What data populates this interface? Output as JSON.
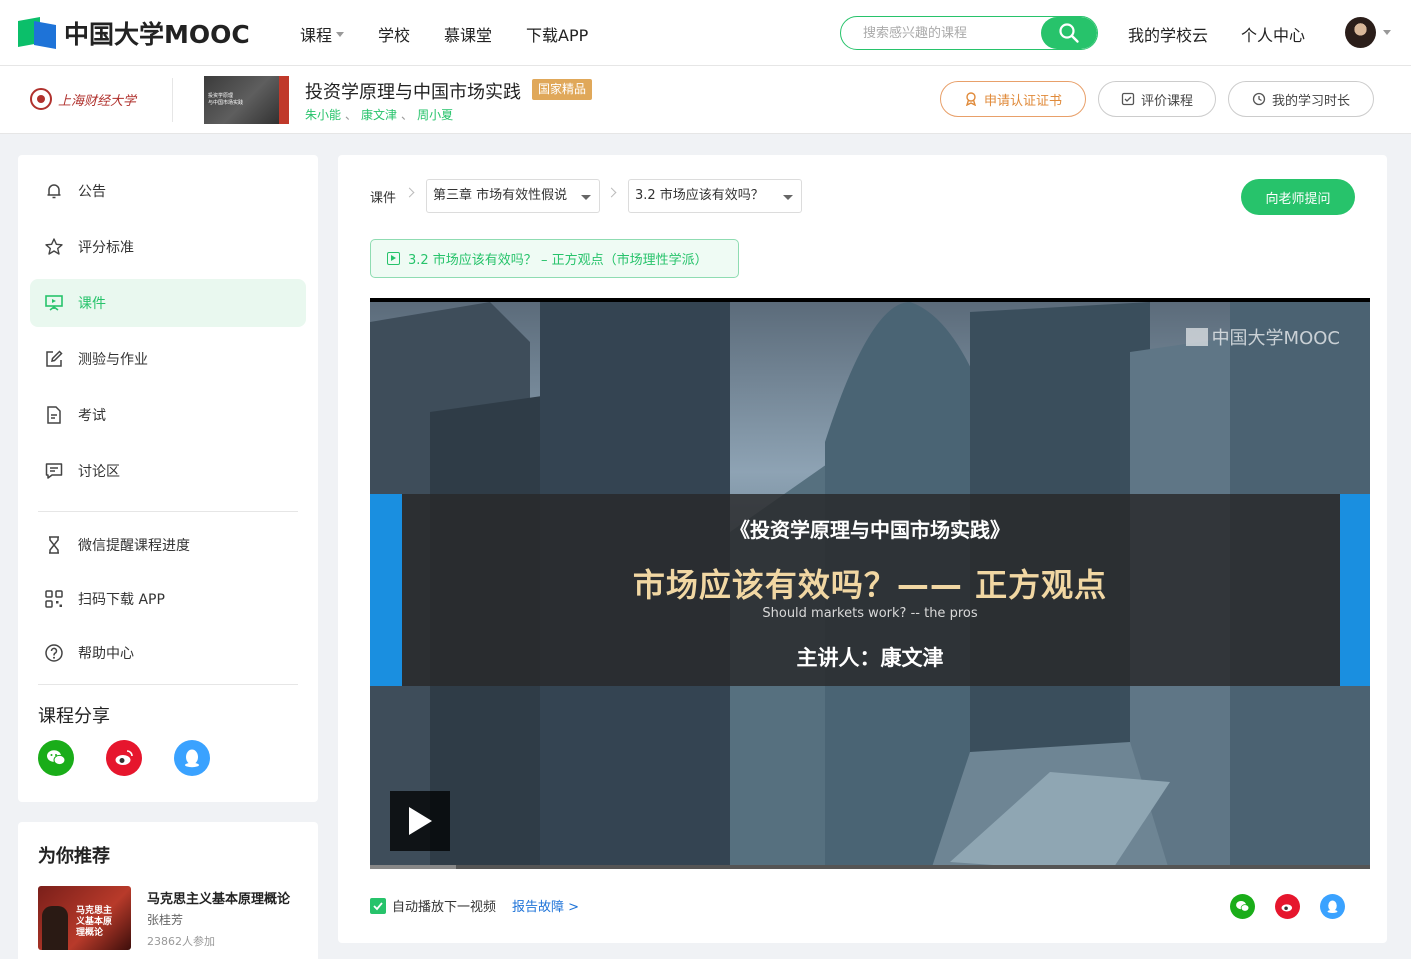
{
  "topbar": {
    "logo_text": "中国大学MOOC",
    "nav": [
      "课程",
      "学校",
      "慕课堂",
      "下载APP"
    ],
    "search_placeholder": "搜索感兴趣的课程",
    "my_school_cloud": "我的学校云",
    "personal_center": "个人中心"
  },
  "course": {
    "school_name": "上海财经大学",
    "thumb_line1": "投资学原理",
    "thumb_line2": "与中国市场实践",
    "title": "投资学原理与中国市场实践",
    "badge": "国家精品",
    "teachers": [
      "朱小能",
      "康文津",
      "周小夏"
    ],
    "teacher_sep": "、",
    "btn_cert": "申请认证证书",
    "btn_review": "评价课程",
    "btn_time": "我的学习时长"
  },
  "sidebar": {
    "items": [
      {
        "label": "公告",
        "icon": "bell-icon"
      },
      {
        "label": "评分标准",
        "icon": "star-icon"
      },
      {
        "label": "课件",
        "icon": "courseware-icon",
        "active": true
      },
      {
        "label": "测验与作业",
        "icon": "edit-icon"
      },
      {
        "label": "考试",
        "icon": "document-icon"
      },
      {
        "label": "讨论区",
        "icon": "chat-icon"
      }
    ],
    "tools": [
      {
        "label": "微信提醒课程进度",
        "icon": "hourglass-icon"
      },
      {
        "label": "扫码下载 APP",
        "icon": "qr-icon"
      },
      {
        "label": "帮助中心",
        "icon": "help-icon"
      }
    ],
    "share_title": "课程分享"
  },
  "recommend": {
    "title": "为你推荐",
    "thumb_text": "马克思主义基本原理概论",
    "name": "马克思主义基本原理概论",
    "teacher": "张桂芳",
    "count": "23862人参加"
  },
  "main": {
    "crumb_label": "课件",
    "chapter_select": "第三章 市场有效性假说",
    "unit_select": "3.2 市场应该有效吗？",
    "ask_btn": "向老师提问",
    "unit_tag": "3.2 市场应该有效吗？ – 正方观点（市场理性学派）",
    "video": {
      "watermark": "中国大学MOOC",
      "line1": "《投资学原理与中国市场实践》",
      "line2": "市场应该有效吗？—— 正方观点",
      "line3": "Should markets work? -- the pros",
      "line4": "主讲人：康文津",
      "progress": 0.086
    },
    "autoplay_label": "自动播放下一视频",
    "autoplay_checked": true,
    "report_label": "报告故障 >"
  },
  "colors": {
    "accent": "#27c36b",
    "link": "#1e73d8",
    "badge": "#e0a85a",
    "wechat": "#1aad19",
    "weibo": "#e6162d",
    "qq": "#3aa2ff"
  }
}
